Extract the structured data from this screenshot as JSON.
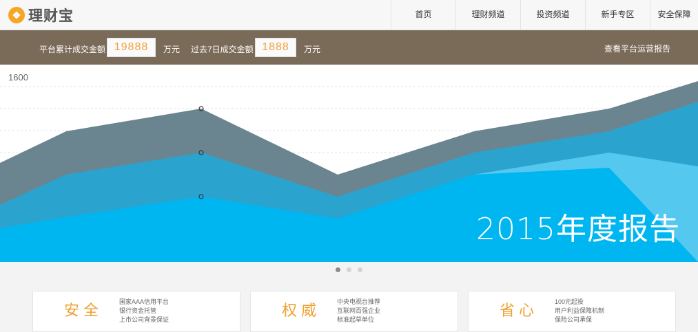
{
  "header": {
    "logo_text": "理财宝",
    "nav": [
      "首页",
      "理财频道",
      "投资频道",
      "新手专区",
      "安全保障"
    ]
  },
  "stats": {
    "total_label": "平台累计成交金额",
    "total_value": "19888",
    "total_unit": "万元",
    "week_label": "过去7日成交金额",
    "week_value": "1888",
    "week_unit": "万元",
    "report_link": "查看平台运营报告"
  },
  "banner": {
    "title": "2015年度报告",
    "y_label": "1600",
    "colors": {
      "back_area": "#6a8590",
      "mid_area": "#2ba3cf",
      "front_area": "#00b6f0",
      "light_area": "#55c8f0"
    }
  },
  "carousel": {
    "dots": 3,
    "active_index": 0
  },
  "cards": [
    {
      "title": "安全",
      "lines": [
        "国家AAA信用平台",
        "银行资金托管",
        "上市公司背景保证"
      ]
    },
    {
      "title": "权威",
      "lines": [
        "中央电视台推荐",
        "互联网百强企业",
        "标准起草单位"
      ]
    },
    {
      "title": "省心",
      "lines": [
        "100元起投",
        "用户利益保障机制",
        "保险公司承保"
      ]
    }
  ]
}
